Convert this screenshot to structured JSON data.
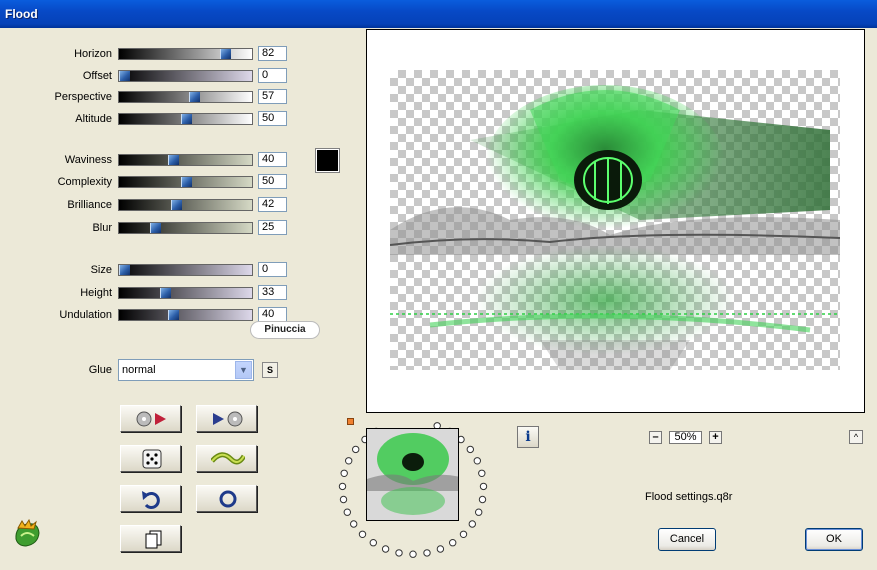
{
  "window": {
    "title": "Flood"
  },
  "params": [
    {
      "key": "horizon",
      "label": "Horizon",
      "value": "82"
    },
    {
      "key": "offset",
      "label": "Offset",
      "value": "0"
    },
    {
      "key": "perspective",
      "label": "Perspective",
      "value": "57"
    },
    {
      "key": "altitude",
      "label": "Altitude",
      "value": "50"
    },
    {
      "key": "waviness",
      "label": "Waviness",
      "value": "40"
    },
    {
      "key": "complexity",
      "label": "Complexity",
      "value": "50"
    },
    {
      "key": "brilliance",
      "label": "Brilliance",
      "value": "42"
    },
    {
      "key": "blur",
      "label": "Blur",
      "value": "25"
    },
    {
      "key": "size",
      "label": "Size",
      "value": "0"
    },
    {
      "key": "height",
      "label": "Height",
      "value": "33"
    },
    {
      "key": "undulation",
      "label": "Undulation",
      "value": "40"
    }
  ],
  "signature": "Pinuccia",
  "glue": {
    "label": "Glue",
    "value": "normal",
    "save_label": "S"
  },
  "colors": {
    "color_swatch": "#000000",
    "accent": "#0749c6"
  },
  "toolbar_icons": [
    "load-preset-icon",
    "save-preset-icon",
    "randomize-dice-icon",
    "wave-icon",
    "undo-icon",
    "reset-icon",
    "copy-icon"
  ],
  "preview": {
    "zoom": "50%",
    "info_label": "i",
    "caret_label": "^"
  },
  "settings_file": "Flood settings.q8r",
  "buttons": {
    "cancel": "Cancel",
    "ok": "OK"
  }
}
